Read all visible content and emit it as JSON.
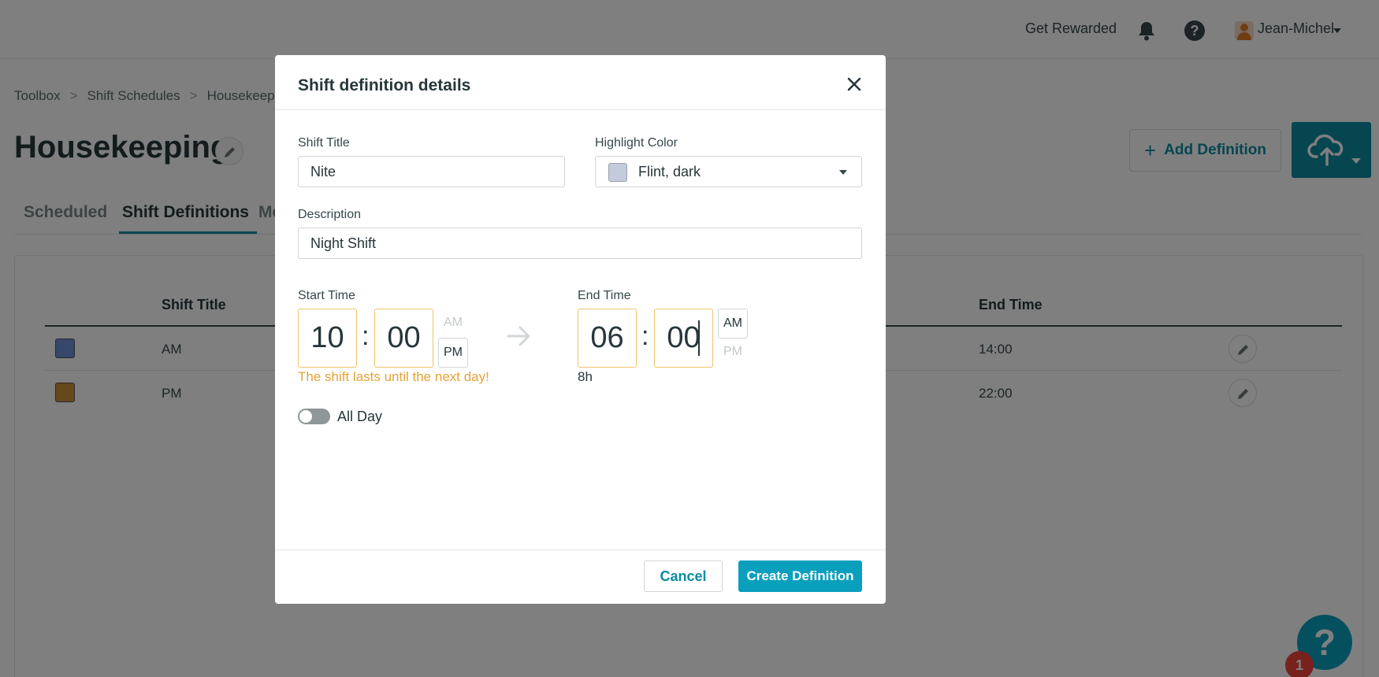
{
  "topbar": {
    "rewards_label": "Get Rewarded",
    "user_name": "Jean-Michel"
  },
  "breadcrumb": [
    "Toolbox",
    "Shift Schedules",
    "Housekeeping"
  ],
  "page": {
    "title": "Housekeeping",
    "add_definition_label": "Add Definition",
    "tabs": [
      "Scheduled",
      "Shift Definitions",
      "Me"
    ]
  },
  "table": {
    "columns": {
      "shift_title": "Shift Title",
      "end_time": "End Time"
    },
    "rows": [
      {
        "color": "#6b8fd4",
        "title": "AM",
        "end": "14:00"
      },
      {
        "color": "#c9923a",
        "title": "PM",
        "end": "22:00"
      }
    ]
  },
  "help_fab": {
    "label": "?",
    "badge": "1"
  },
  "modal": {
    "title": "Shift definition details",
    "shift_title_label": "Shift Title",
    "shift_title_value": "Nite",
    "highlight_color_label": "Highlight Color",
    "highlight_color_value": "Flint, dark",
    "highlight_color_hex": "#c3cbdc",
    "description_label": "Description",
    "description_value": "Night Shift",
    "start_time": {
      "label": "Start Time",
      "hour": "10",
      "minute": "00",
      "am": "AM",
      "pm": "PM",
      "selected": "PM"
    },
    "end_time": {
      "label": "End Time",
      "hour": "06",
      "minute": "00",
      "am": "AM",
      "pm": "PM",
      "selected": "AM"
    },
    "colon": ":",
    "next_day_warning": "The shift lasts until the next day!",
    "duration": "8h",
    "all_day_label": "All Day",
    "all_day_on": false,
    "cancel_label": "Cancel",
    "create_label": "Create Definition"
  },
  "colors": {
    "accent": "#0a8ca1",
    "primary_button": "#0a9fbd",
    "warning": "#e5a236",
    "badge": "#f0443c"
  }
}
